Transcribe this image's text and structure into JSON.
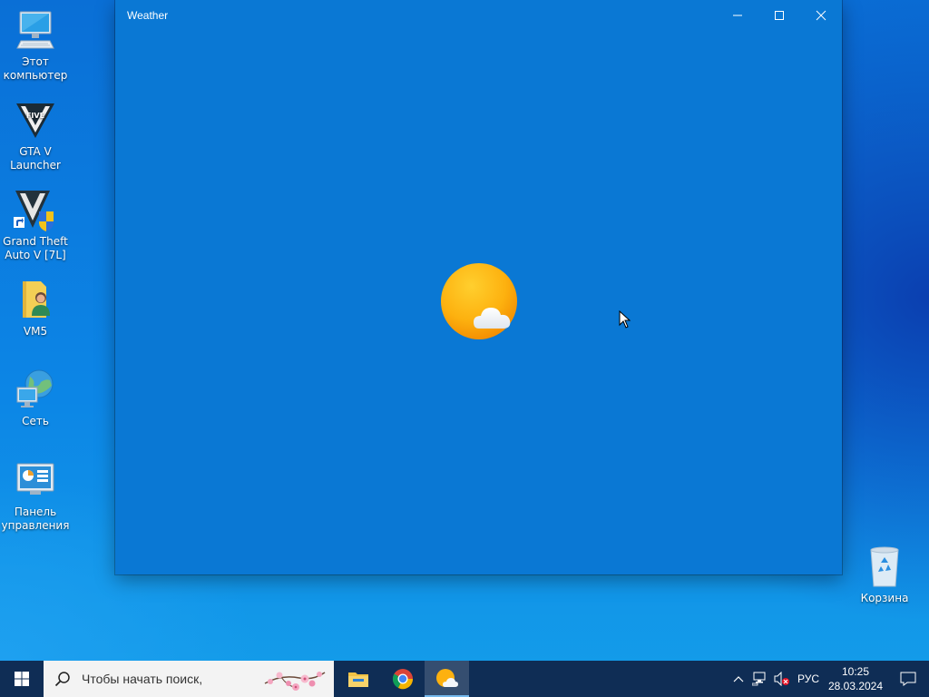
{
  "desktop": {
    "icons": [
      {
        "label": "Этот компьютер"
      },
      {
        "label": "GTA V Launcher"
      },
      {
        "label": "Grand Theft Auto V [7L]"
      },
      {
        "label": "VM5"
      },
      {
        "label": "Сеть"
      },
      {
        "label": "Панель управления"
      },
      {
        "label": "Корзина"
      }
    ]
  },
  "window": {
    "title": "Weather",
    "background_color": "#0a78d4",
    "splash_icon": "weather-sun-cloud-icon"
  },
  "taskbar": {
    "search_placeholder": "Чтобы начать поиск,",
    "apps": [
      {
        "name": "file-explorer-icon",
        "active": false
      },
      {
        "name": "chrome-icon",
        "active": false
      },
      {
        "name": "weather-app-icon",
        "active": true
      }
    ],
    "tray": {
      "language": "РУС",
      "time": "10:25",
      "date": "28.03.2024"
    }
  }
}
